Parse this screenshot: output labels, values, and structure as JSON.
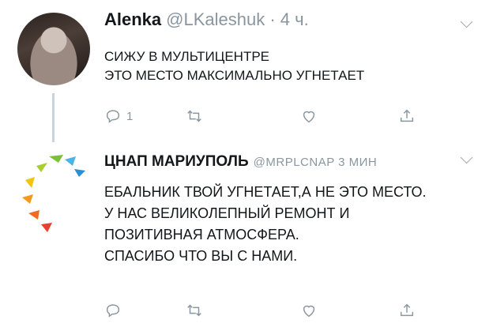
{
  "tweet1": {
    "author_name": "Alenka",
    "handle_time": "@LKaleshuk · 4 ч.",
    "text": "СИЖУ В МУЛЬТИЦЕНТРЕ\nЭТО МЕСТО МАКСИМАЛЬНО УГНЕТАЕТ",
    "reply_count": "1"
  },
  "tweet2": {
    "author_name": "ЦНАП МАРИУПОЛЬ",
    "handle_time": "@MRPLCNAP  3 МИН",
    "text": "ЕБАЛЬНИК ТВОЙ УГНЕТАЕТ,А НЕ ЭТО МЕСТО.\nУ НАС ВЕЛИКОЛЕПНЫЙ РЕМОНТ И\nПОЗИТИВНАЯ АТМОСФЕРА.\nСПАСИБО ЧТО ВЫ С НАМИ."
  },
  "colors": {
    "text": "#14171a",
    "secondary": "#8a969f",
    "thread_line": "#c8d3db"
  },
  "icons": [
    "reply-icon",
    "retweet-icon",
    "like-icon",
    "share-icon",
    "chevron-down-icon"
  ]
}
